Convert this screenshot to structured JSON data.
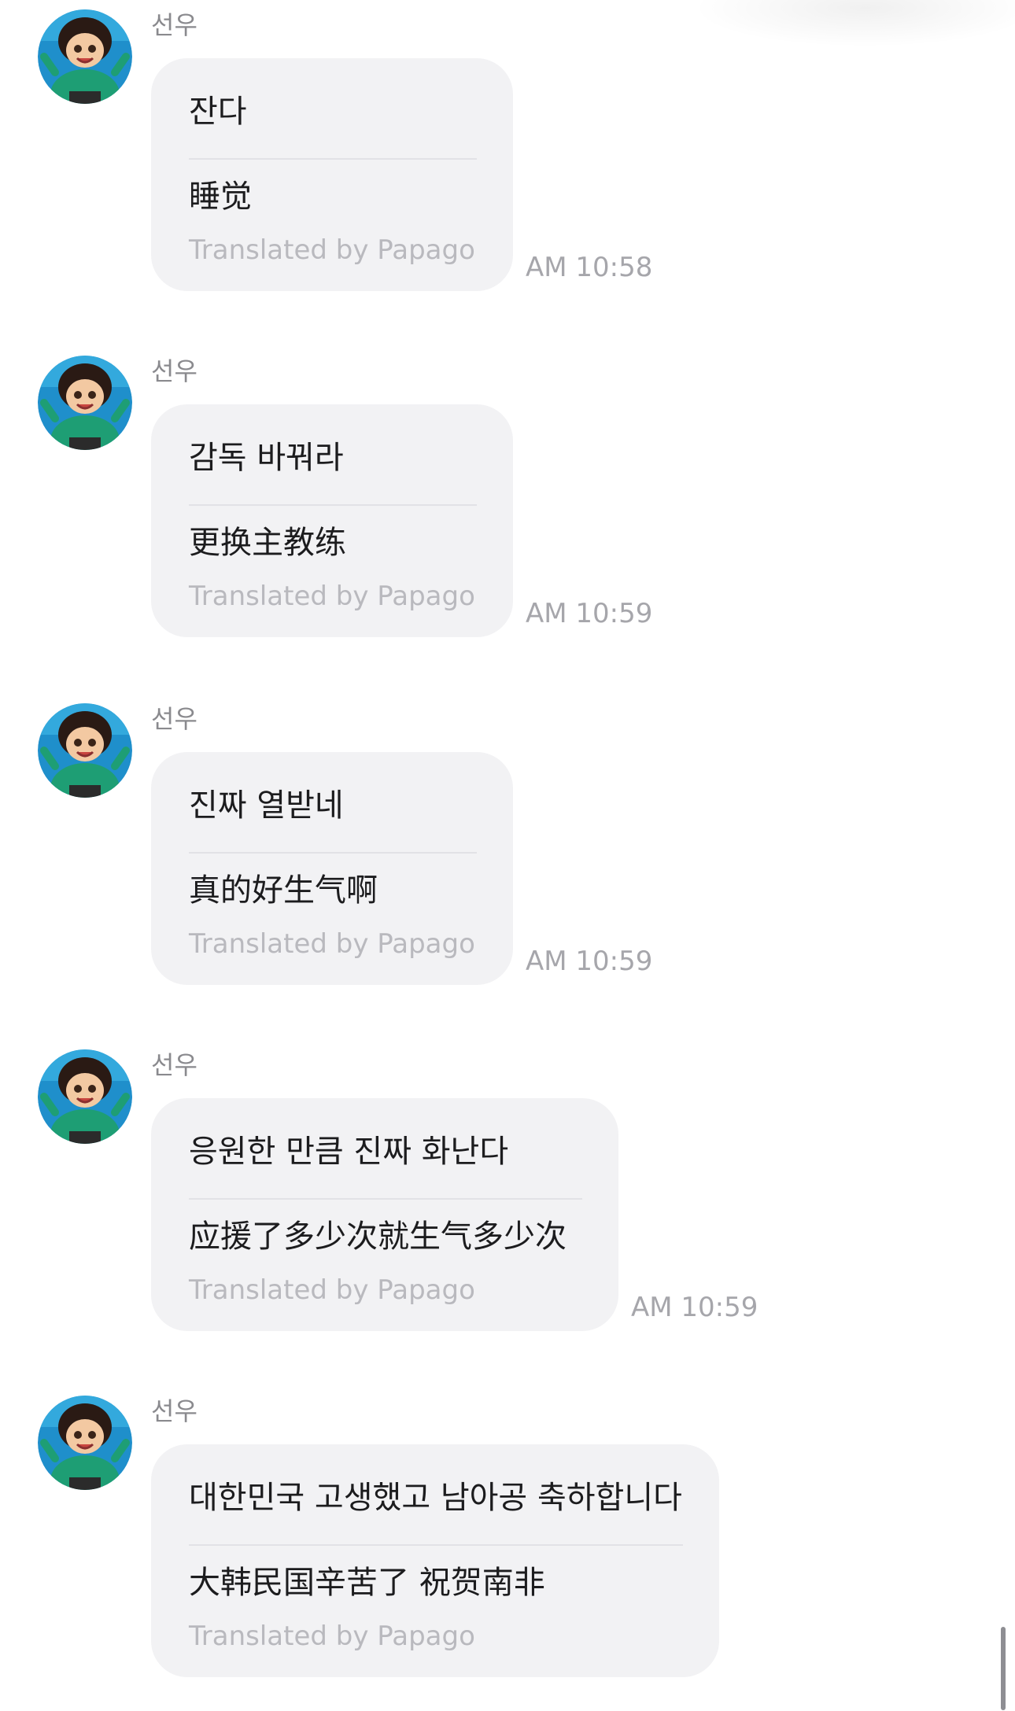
{
  "colors": {
    "bubble_bg": "#f2f2f4",
    "text": "#1c1c1e",
    "secondary_text": "#8a8a8e",
    "credit_text": "#b9b9be",
    "timestamp_text": "#a6a6ab",
    "avatar_icon": "cartoon-girl-avatar-icon"
  },
  "messages": [
    {
      "sender": "선우",
      "original": "잔다",
      "translation": "睡觉",
      "credit": "Translated by Papago",
      "time": "AM 10:58"
    },
    {
      "sender": "선우",
      "original": "감독 바꿔라",
      "translation": "更换主教练",
      "credit": "Translated by Papago",
      "time": "AM 10:59"
    },
    {
      "sender": "선우",
      "original": " 진짜 열받네",
      "translation": "真的好生气啊",
      "credit": "Translated by Papago",
      "time": "AM 10:59"
    },
    {
      "sender": "선우",
      "original": "응원한 만큼 진짜 화난다",
      "translation": "应援了多少次就生气多少次",
      "credit": "Translated by Papago",
      "time": "AM 10:59"
    },
    {
      "sender": "선우",
      "original": " 대한민국 고생했고 남아공 축하합니다",
      "translation": "大韩民国辛苦了 祝贺南非",
      "credit": "Translated by Papago",
      "time": ""
    }
  ]
}
